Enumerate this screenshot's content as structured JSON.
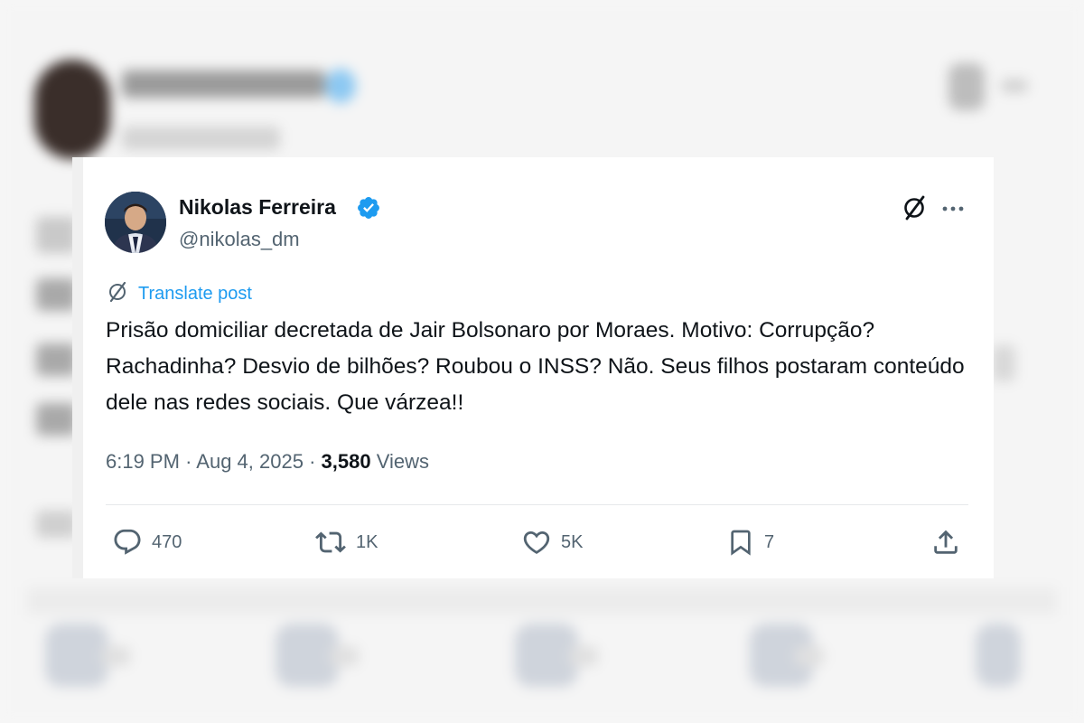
{
  "post": {
    "author_name": "Nikolas Ferreira",
    "author_handle": "@nikolas_dm",
    "translate_label": "Translate post",
    "text": "Prisão domiciliar decretada de Jair Bolsonaro por Moraes. Motivo: Corrupção? Rachadinha? Desvio de bilhões? Roubou o INSS? Não. Seus filhos postaram conteúdo dele nas redes sociais. Que várzea!!",
    "time": "6:19 PM",
    "date": "Aug 4, 2025",
    "views_count": "3,580",
    "views_label": "Views"
  },
  "actions": {
    "replies": "470",
    "reposts": "1K",
    "likes": "5K",
    "bookmarks": "7"
  },
  "icons": [
    "verified-badge-icon",
    "grok-icon",
    "more-icon",
    "translate-icon",
    "reply-icon",
    "repost-icon",
    "like-icon",
    "bookmark-icon",
    "share-icon"
  ],
  "colors": {
    "accent": "#1d9bf0",
    "text_primary": "#0f1419",
    "text_secondary": "#536471"
  }
}
